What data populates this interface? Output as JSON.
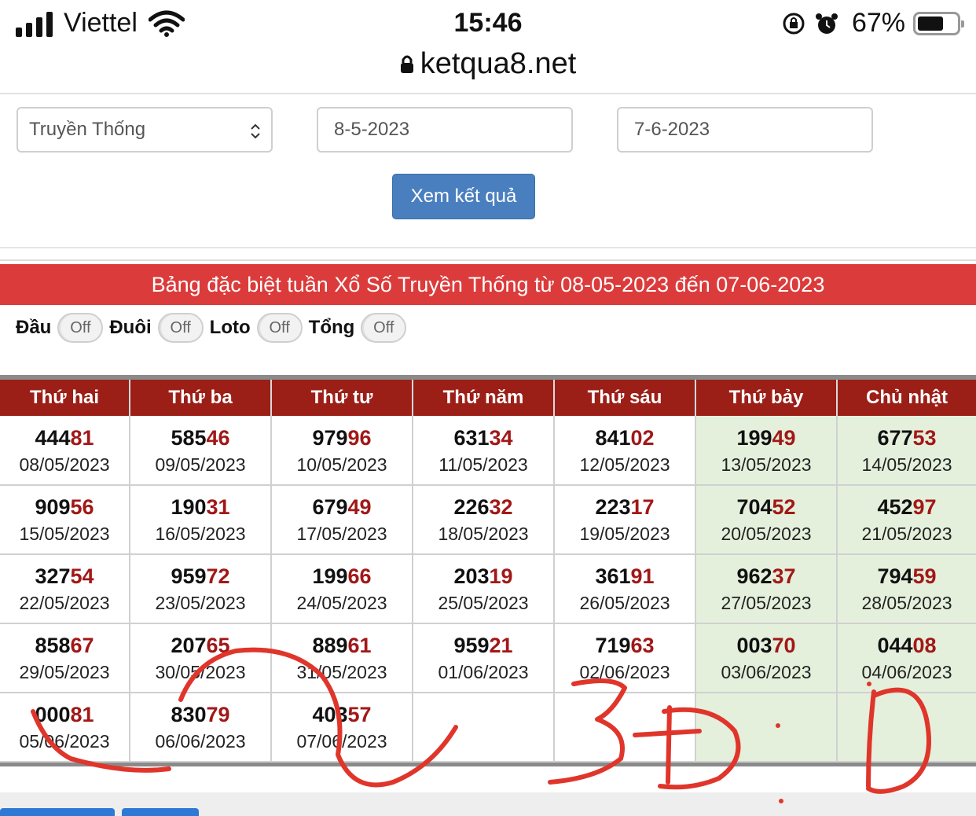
{
  "status_bar": {
    "carrier": "Viettel",
    "time": "15:46",
    "battery": "67%",
    "battery_level": 0.67
  },
  "browser": {
    "url": "ketqua8.net"
  },
  "form": {
    "lottery_type": "Truyền Thống",
    "from_date": "8-5-2023",
    "to_date": "7-6-2023",
    "submit_label": "Xem kết quả"
  },
  "banner": {
    "title": "Bảng đặc biệt tuần Xổ Số Truyền Thống từ 08-05-2023 đến 07-06-2023"
  },
  "toggles": [
    {
      "label": "Đầu",
      "state": "Off"
    },
    {
      "label": "Đuôi",
      "state": "Off"
    },
    {
      "label": "Loto",
      "state": "Off"
    },
    {
      "label": "Tổng",
      "state": "Off"
    }
  ],
  "table": {
    "headers": [
      "Thứ hai",
      "Thứ ba",
      "Thứ tư",
      "Thứ năm",
      "Thứ sáu",
      "Thứ bảy",
      "Chủ nhật"
    ],
    "rows": [
      [
        {
          "head": "444",
          "tail": "81",
          "date": "08/05/2023"
        },
        {
          "head": "585",
          "tail": "46",
          "date": "09/05/2023"
        },
        {
          "head": "979",
          "tail": "96",
          "date": "10/05/2023"
        },
        {
          "head": "631",
          "tail": "34",
          "date": "11/05/2023"
        },
        {
          "head": "841",
          "tail": "02",
          "date": "12/05/2023"
        },
        {
          "head": "199",
          "tail": "49",
          "date": "13/05/2023"
        },
        {
          "head": "677",
          "tail": "53",
          "date": "14/05/2023"
        }
      ],
      [
        {
          "head": "909",
          "tail": "56",
          "date": "15/05/2023"
        },
        {
          "head": "190",
          "tail": "31",
          "date": "16/05/2023"
        },
        {
          "head": "679",
          "tail": "49",
          "date": "17/05/2023"
        },
        {
          "head": "226",
          "tail": "32",
          "date": "18/05/2023"
        },
        {
          "head": "223",
          "tail": "17",
          "date": "19/05/2023"
        },
        {
          "head": "704",
          "tail": "52",
          "date": "20/05/2023"
        },
        {
          "head": "452",
          "tail": "97",
          "date": "21/05/2023"
        }
      ],
      [
        {
          "head": "327",
          "tail": "54",
          "date": "22/05/2023"
        },
        {
          "head": "959",
          "tail": "72",
          "date": "23/05/2023"
        },
        {
          "head": "199",
          "tail": "66",
          "date": "24/05/2023"
        },
        {
          "head": "203",
          "tail": "19",
          "date": "25/05/2023"
        },
        {
          "head": "361",
          "tail": "91",
          "date": "26/05/2023"
        },
        {
          "head": "962",
          "tail": "37",
          "date": "27/05/2023"
        },
        {
          "head": "794",
          "tail": "59",
          "date": "28/05/2023"
        }
      ],
      [
        {
          "head": "858",
          "tail": "67",
          "date": "29/05/2023"
        },
        {
          "head": "207",
          "tail": "65",
          "date": "30/05/2023"
        },
        {
          "head": "889",
          "tail": "61",
          "date": "31/05/2023"
        },
        {
          "head": "959",
          "tail": "21",
          "date": "01/06/2023"
        },
        {
          "head": "719",
          "tail": "63",
          "date": "02/06/2023"
        },
        {
          "head": "003",
          "tail": "70",
          "date": "03/06/2023"
        },
        {
          "head": "044",
          "tail": "08",
          "date": "04/06/2023"
        }
      ],
      [
        {
          "head": "000",
          "tail": "81",
          "date": "05/06/2023"
        },
        {
          "head": "830",
          "tail": "79",
          "date": "06/06/2023"
        },
        {
          "head": "403",
          "tail": "57",
          "date": "07/06/2023"
        },
        null,
        null,
        null,
        null
      ]
    ]
  },
  "colors": {
    "banner": "#dc3b3b",
    "header": "#9b1f17",
    "weekend": "#e4f0dc",
    "tail_digits": "#a11818",
    "button": "#4a7fbf"
  },
  "icons": [
    "wifi-icon",
    "lock-icon",
    "rotation-lock-icon",
    "alarm-icon",
    "chevron-updown-icon"
  ]
}
